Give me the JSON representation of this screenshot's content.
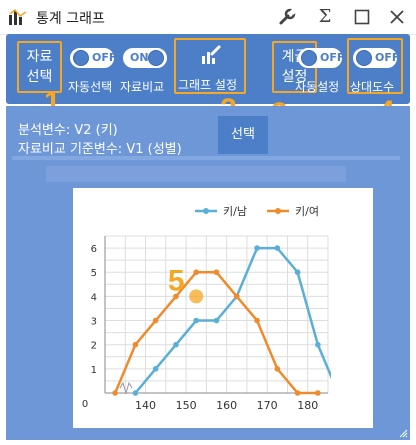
{
  "window": {
    "title": "통계 그래프",
    "controls": [
      "wrench-icon",
      "sigma-icon",
      "maximize-icon",
      "close-icon"
    ]
  },
  "toolbar": {
    "data_select": {
      "line1": "자료",
      "line2": "선택"
    },
    "auto_select": {
      "label": "자동선택",
      "state": "OFF"
    },
    "data_compare": {
      "label": "자료비교",
      "state": "ON"
    },
    "graph_settings": {
      "label": "그래프 설정"
    },
    "class_settings": {
      "line1": "계급",
      "line2": "설정"
    },
    "auto_settings": {
      "label": "자동설정",
      "state": "OFF"
    },
    "relative_freq": {
      "label": "상대도수",
      "state": "OFF"
    }
  },
  "markers": [
    "1",
    "2",
    "3",
    "4",
    "5"
  ],
  "info": {
    "analysis_var": "분석변수: V2 (키)",
    "compare_var": "자료비교 기준변수: V1 (성별)",
    "select_button": "선택"
  },
  "colors": {
    "accent": "#4d7fc9",
    "panel": "#6e97d8",
    "highlight": "#f5a623",
    "series_male": "#5aafd6",
    "series_female": "#ef8b2c"
  },
  "chart_data": {
    "type": "line",
    "title": "",
    "xlabel": "",
    "ylabel": "",
    "x_ticks": [
      "140",
      "150",
      "160",
      "170",
      "180"
    ],
    "y_ticks": [
      "0",
      "1",
      "2",
      "3",
      "4",
      "5",
      "6"
    ],
    "origin_label": "0",
    "xlim": [
      130,
      185
    ],
    "ylim": [
      0,
      6.5
    ],
    "grid": true,
    "legend_position": "top-right",
    "series": [
      {
        "name": "키/남",
        "color": "#5aafd6",
        "x": [
          137.5,
          142.5,
          147.5,
          152.5,
          157.5,
          162.5,
          167.5,
          172.5,
          177.5,
          182.5,
          187.5
        ],
        "y": [
          0,
          1,
          2,
          3,
          3,
          4,
          6,
          6,
          5,
          2,
          0
        ]
      },
      {
        "name": "키/여",
        "color": "#ef8b2c",
        "x": [
          132.5,
          137.5,
          142.5,
          147.5,
          152.5,
          157.5,
          162.5,
          167.5,
          172.5,
          177.5,
          182.5
        ],
        "y": [
          0,
          2,
          3,
          4,
          5,
          5,
          4,
          3,
          1,
          0,
          0
        ]
      }
    ]
  }
}
